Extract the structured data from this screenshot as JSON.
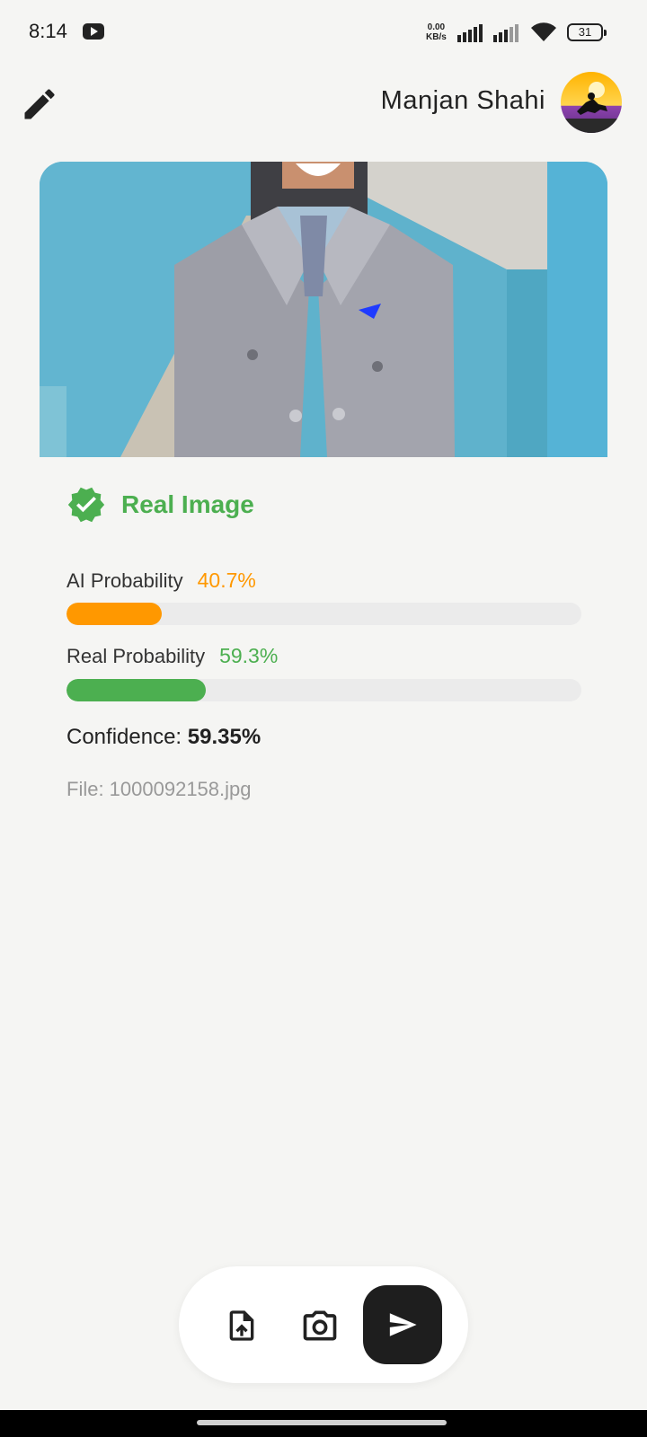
{
  "status_bar": {
    "time": "8:14",
    "net_speed_value": "0.00",
    "net_speed_unit": "KB/s",
    "battery": "31",
    "icons": [
      "youtube-icon",
      "signal-icon",
      "signal-icon",
      "wifi-icon",
      "battery-icon"
    ]
  },
  "header": {
    "edit_icon": "pencil-icon",
    "user_name": "Manjan Shahi"
  },
  "result": {
    "icon": "verified-check-icon",
    "label": "Real Image",
    "label_color": "#4caf50"
  },
  "probabilities": [
    {
      "label": "AI Probability",
      "value": "40.7%",
      "fraction": 0.407,
      "color": "#ff9800"
    },
    {
      "label": "Real Probability",
      "value": "59.3%",
      "fraction": 0.593,
      "color": "#4caf50"
    }
  ],
  "confidence": {
    "label": "Confidence:",
    "value": "59.35%"
  },
  "file": {
    "label": "File: 1000092158.jpg"
  },
  "actions": {
    "icons": [
      "upload-file-icon",
      "camera-icon",
      "send-icon"
    ]
  },
  "colors": {
    "background": "#f5f5f3",
    "ai_bar": "#ff9800",
    "real_bar": "#4caf50",
    "track": "#ebebeb",
    "send_button": "#1e1e1e"
  }
}
